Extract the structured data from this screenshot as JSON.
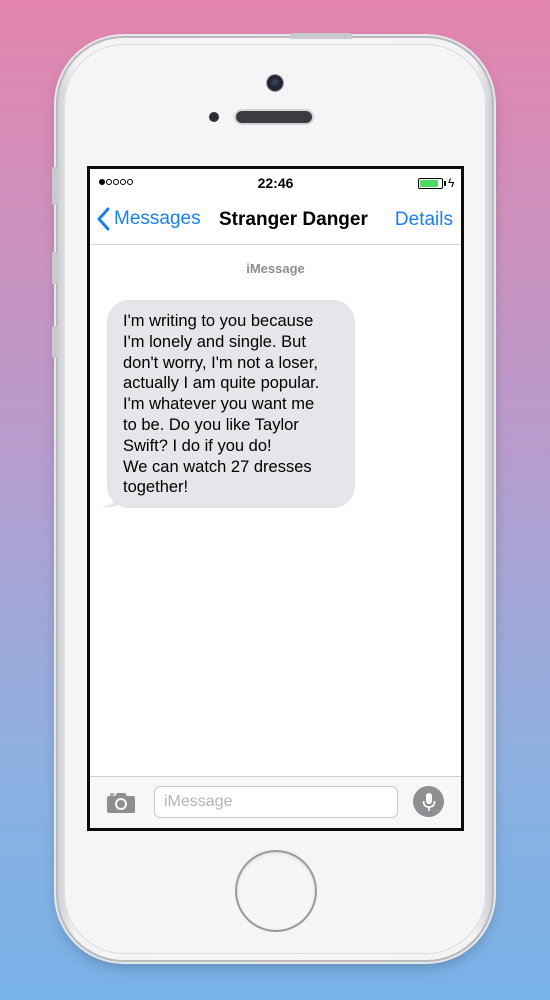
{
  "status_bar": {
    "signal_filled": 1,
    "signal_empty": 4,
    "time": "22:46",
    "battery_level": 0.85,
    "battery_color": "#4cd964",
    "charging_icon": "bolt-icon"
  },
  "nav": {
    "back_icon": "chevron-left-icon",
    "back_label": "Messages",
    "title": "Stranger Danger",
    "details_label": "Details",
    "accent_color": "#1a7ff0"
  },
  "conversation": {
    "service_label": "iMessage",
    "messages": [
      {
        "direction": "received",
        "text": "I'm writing to you because\nI'm lonely and single. But\ndon't worry, I'm not a loser,\nactually I am quite popular.\nI'm whatever you want me\nto be. Do you like Taylor\nSwift? I do if you do!\nWe can watch 27 dresses\ntogether!"
      }
    ]
  },
  "composer": {
    "camera_icon": "camera-icon",
    "input_placeholder": "iMessage",
    "input_value": "",
    "mic_icon": "microphone-icon"
  }
}
